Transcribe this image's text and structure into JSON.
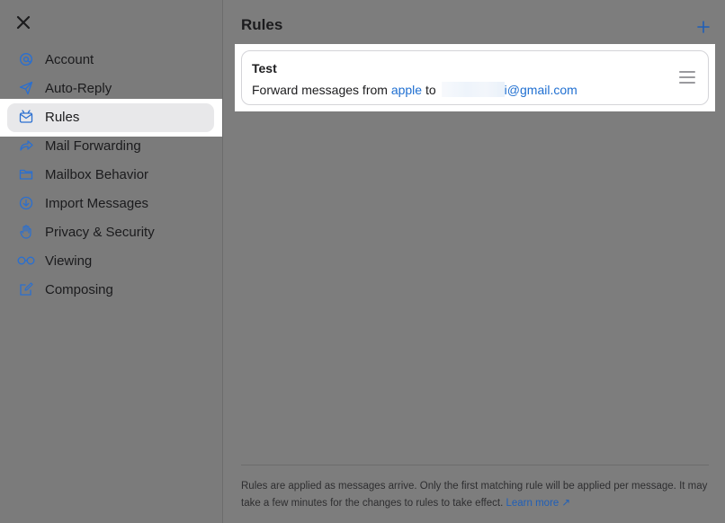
{
  "sidebar": {
    "close_label": "✕",
    "items": [
      {
        "label": "Account",
        "icon": "at-icon"
      },
      {
        "label": "Auto-Reply",
        "icon": "paper-plane-icon"
      },
      {
        "label": "Rules",
        "icon": "rules-envelope-icon",
        "selected": true
      },
      {
        "label": "Mail Forwarding",
        "icon": "forward-arrow-icon"
      },
      {
        "label": "Mailbox Behavior",
        "icon": "folder-icon"
      },
      {
        "label": "Import Messages",
        "icon": "download-circle-icon"
      },
      {
        "label": "Privacy & Security",
        "icon": "hand-icon"
      },
      {
        "label": "Viewing",
        "icon": "glasses-icon"
      },
      {
        "label": "Composing",
        "icon": "compose-icon"
      }
    ]
  },
  "main": {
    "title": "Rules",
    "add_label": "+",
    "rule": {
      "title": "Test",
      "desc_prefix": "Forward messages from",
      "desc_sender": "apple",
      "desc_to": "to",
      "desc_email": "i@gmail.com"
    },
    "footer": {
      "text": "Rules are applied as messages arrive. Only the first matching rule will be applied per message. It may take a few minutes for the changes to rules to take effect.",
      "link": "Learn more ↗"
    }
  },
  "colors": {
    "accent": "#1f6fd1",
    "background": "#7d7d7d",
    "highlight": "#ffffff"
  }
}
